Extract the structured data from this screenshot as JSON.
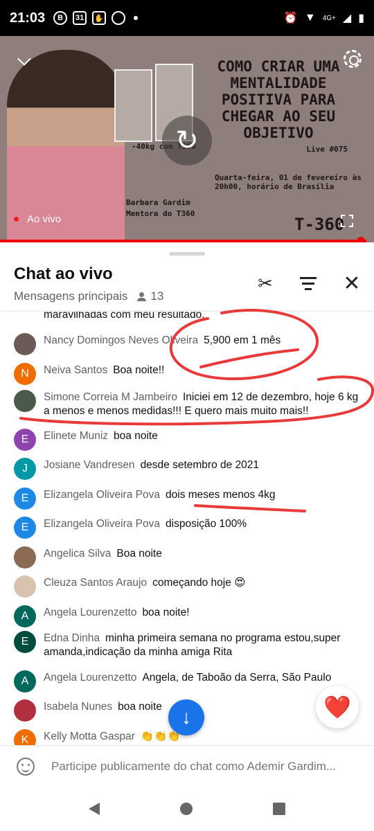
{
  "status_bar": {
    "time": "21:03",
    "icon_b": "B",
    "icon_cal": "31",
    "network": "4G+"
  },
  "video": {
    "title": "COMO CRIAR UMA MENTALIDADE POSITIVA PARA CHEGAR AO SEU OBJETIVO",
    "live_number": "Live #075",
    "schedule": "Quarta-feira, 01 de fevereiro às 20h00, horário de Brasília",
    "presenter_name": "Barbara Gardim",
    "presenter_role": "Mentora do T360",
    "photo_caption": "-40kg com T360",
    "brand": "T-360",
    "live_label": "Ao vivo",
    "progress": 0.98
  },
  "chat": {
    "title": "Chat ao vivo",
    "subtitle": "Mensagens principais",
    "viewers": "13",
    "partial_top": "maravilhadas com meu resultado.",
    "messages": [
      {
        "author": "Nancy Domingos Neves Oliveira",
        "text": "5,900 em 1 mês",
        "avatar_letter": "",
        "avatar_color": "#6b5a55"
      },
      {
        "author": "Neiva Santos",
        "text": "Boa noite!!",
        "avatar_letter": "N",
        "avatar_color": "#ef6c00"
      },
      {
        "author": "Simone Correia M Jambeiro",
        "text": "Iniciei em 12 de dezembro, hoje 6 kg a menos e menos medidas!!! E quero mais muito mais!!",
        "avatar_letter": "",
        "avatar_color": "#4a5a4a"
      },
      {
        "author": "Elinete Muniz",
        "text": "boa noite",
        "avatar_letter": "E",
        "avatar_color": "#8e44ad"
      },
      {
        "author": "Josiane Vandresen",
        "text": "desde setembro de 2021",
        "avatar_letter": "J",
        "avatar_color": "#0097a7"
      },
      {
        "author": "Elizangela Oliveira Pova",
        "text": "dois meses menos 4kg",
        "avatar_letter": "E",
        "avatar_color": "#1e88e5"
      },
      {
        "author": "Elizangela Oliveira Pova",
        "text": "disposição 100%",
        "avatar_letter": "E",
        "avatar_color": "#1e88e5"
      },
      {
        "author": "Angelica Silva",
        "text": "Boa noite",
        "avatar_letter": "",
        "avatar_color": "#8a6a55"
      },
      {
        "author": "Cleuza Santos Araujo",
        "text": "começando hoje 😍",
        "avatar_letter": "",
        "avatar_color": "#d8c3b0"
      },
      {
        "author": "Angela Lourenzetto",
        "text": "boa noite!",
        "avatar_letter": "A",
        "avatar_color": "#00695c"
      },
      {
        "author": "Edna Dinha",
        "text": "minha primeira semana no programa estou,super amanda,indicação da minha amiga Rita",
        "avatar_letter": "E",
        "avatar_color": "#004d40"
      },
      {
        "author": "Angela Lourenzetto",
        "text": "Angela, de Taboão da Serra, São Paulo",
        "avatar_letter": "A",
        "avatar_color": "#00695c"
      },
      {
        "author": "Isabela Nunes",
        "text": "boa noite",
        "avatar_letter": "",
        "avatar_color": "#b03040"
      },
      {
        "author": "Kelly Motta Gaspar",
        "text": "👏👏👏",
        "avatar_letter": "K",
        "avatar_color": "#ef6c00"
      }
    ],
    "reaction": "❤️",
    "input_placeholder": "Participe publicamente do chat como Ademir Gardim..."
  },
  "colors": {
    "live_red": "#ff0000",
    "annotation_red": "#e83a3a",
    "scroll_blue": "#1a73e8"
  },
  "icons": [
    "chevron-down-icon",
    "gear-icon",
    "replay-icon",
    "fullscreen-icon",
    "clip-icon",
    "filter-icon",
    "close-icon",
    "arrow-down-icon",
    "heart-icon",
    "emoji-icon"
  ]
}
